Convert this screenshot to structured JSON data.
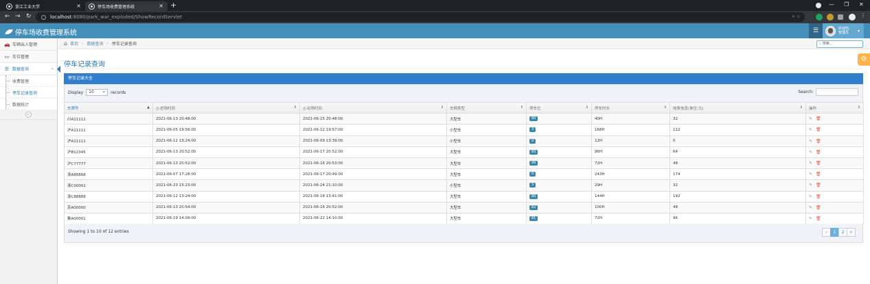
{
  "browser": {
    "tabs": [
      {
        "title": "浙江工业大学",
        "active": false
      },
      {
        "title": "停车场收费管理系统",
        "active": true
      }
    ],
    "new_tab": "+",
    "url_host": "localhost",
    "url_path": ":8080/park_war_exploded/ShowRecordServlet",
    "window_controls": {
      "minimize": "—",
      "maximize": "❐",
      "close": "✕"
    }
  },
  "app": {
    "brand": "停车场收费管理系统",
    "user_greeting": "欢迎你,",
    "user_name": "管理员",
    "accent_color": "#438eb9"
  },
  "sidebar": {
    "items": [
      {
        "label": "车辆出入管理",
        "icon": "car-icon",
        "glyph": "🚗"
      },
      {
        "label": "车位管理",
        "icon": "parking-icon",
        "glyph": "▭"
      },
      {
        "label": "数据查询",
        "icon": "list-icon",
        "glyph": "☰"
      }
    ],
    "sub_items": [
      {
        "label": "收费管理"
      },
      {
        "label": "停车记录查询"
      },
      {
        "label": "数据统计"
      }
    ]
  },
  "breadcrumbs": {
    "home": "首页",
    "section": "数据查询",
    "current": "停车记录查询"
  },
  "nav_search": {
    "placeholder": "搜索..."
  },
  "page": {
    "title": "停车记录查询",
    "table_title": "停车记录大全"
  },
  "datatable": {
    "length_prefix": "Display",
    "length_value": "10",
    "length_suffix": "records",
    "search_label": "Search:",
    "columns": [
      "车牌号",
      "进场时间",
      "出场时间",
      "车辆类型",
      "停车位",
      "停车时长",
      "收费信息(单位:元)",
      "操作"
    ],
    "rows": [
      {
        "plate": "川A11111",
        "in": "2021-06-13 20:48:00",
        "out": "2021-06-15 20:48:00",
        "type": "大型车",
        "spot": "80",
        "duration": "40H",
        "fee": "32"
      },
      {
        "plate": "沪A11111",
        "in": "2021-06-05 19:56:00",
        "out": "2021-06-12 19:57:00",
        "type": "小型车",
        "spot": "3",
        "duration": "168H",
        "fee": "112"
      },
      {
        "plate": "沪A11111",
        "in": "2021-06-12 13:24:00",
        "out": "2021-06-09 13:39:00",
        "type": "小型车",
        "spot": "0",
        "duration": "12H",
        "fee": "0"
      },
      {
        "plate": "沪B12345",
        "in": "2021-06-13 20:52:00",
        "out": "2021-06-17 20:52:00",
        "type": "大型车",
        "spot": "83",
        "duration": "96H",
        "fee": "64"
      },
      {
        "plate": "沪C77777",
        "in": "2021-06-13 20:52:00",
        "out": "2021-06-16 20:53:00",
        "type": "大型车",
        "spot": "99",
        "duration": "72H",
        "fee": "48"
      },
      {
        "plate": "浙A88888",
        "in": "2021-06-07 17:28:00",
        "out": "2021-06-17 20:49:00",
        "type": "大型车",
        "spot": "0",
        "duration": "243H",
        "fee": "174"
      },
      {
        "plate": "浙C00001",
        "in": "2021-06-23 15:23:00",
        "out": "2021-06-24 21:10:00",
        "type": "小型车",
        "spot": "3",
        "duration": "29H",
        "fee": "32"
      },
      {
        "plate": "浙C88888",
        "in": "2021-06-12 13:24:00",
        "out": "2021-06-18 13:41:00",
        "type": "大型车",
        "spot": "80",
        "duration": "144H",
        "fee": "192"
      },
      {
        "plate": "苏A00000",
        "in": "2021-06-13 20:54:00",
        "out": "2021-06-16 20:52:00",
        "type": "大型车",
        "spot": "82",
        "duration": "100H",
        "fee": "48"
      },
      {
        "plate": "鲁A00001",
        "in": "2021-06-19 14:09:00",
        "out": "2021-06-22 14:10:00",
        "type": "大型车",
        "spot": "81",
        "duration": "72H",
        "fee": "96"
      }
    ],
    "info": "Showing 1 to 10 of 12 entries",
    "pagination": [
      "«",
      "1",
      "2",
      "»"
    ],
    "current_page": "1"
  }
}
